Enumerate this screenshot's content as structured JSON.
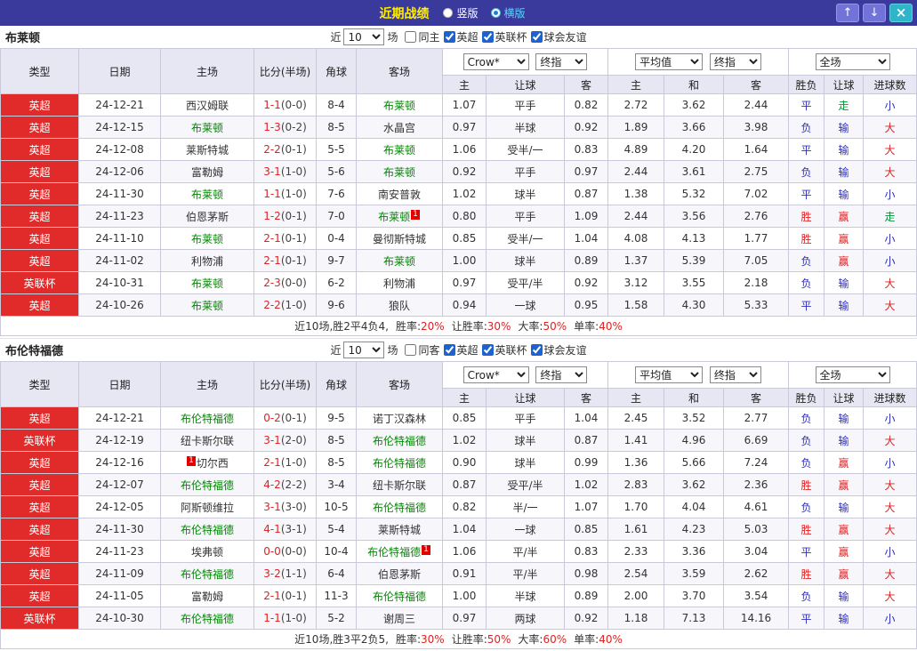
{
  "topbar": {
    "title": "近期战绩",
    "radios": [
      {
        "label": "竖版",
        "selected": false
      },
      {
        "label": "横版",
        "selected": true
      }
    ],
    "buttons": {
      "up": "↑",
      "down": "↓",
      "close": "×"
    }
  },
  "filter_labels": {
    "near": "近",
    "games": "场"
  },
  "table_headers": {
    "col_labels": [
      "类型",
      "日期",
      "主场",
      "比分(半场)",
      "角球",
      "客场"
    ],
    "sub_labels": [
      "主",
      "让球",
      "客",
      "主",
      "和",
      "客",
      "胜负",
      "让球",
      "进球数"
    ],
    "selects": {
      "source": "Crow*",
      "final": "终指",
      "average": "平均值",
      "scope": "全场"
    }
  },
  "result_colors": {
    "胜": "#e02222",
    "赢": "#e02222",
    "大": "#e02222",
    "负": "#2d2dbe",
    "输": "#2d2dbe",
    "小": "#2d2dbe",
    "平": "#2d2dbe",
    "走": "#009933"
  },
  "sections": [
    {
      "team": "布莱顿",
      "filter": {
        "count": "10",
        "same_label": "同主",
        "same_checked": false,
        "leagues": [
          {
            "label": "英超",
            "checked": true
          },
          {
            "label": "英联杯",
            "checked": true
          },
          {
            "label": "球会友谊",
            "checked": true
          }
        ]
      },
      "rows": [
        {
          "league": "英超",
          "date": "24-12-21",
          "home": "西汉姆联",
          "home_focus": false,
          "score": "1-1",
          "half": "(0-0)",
          "corner": "8-4",
          "away": "布莱顿",
          "away_focus": true,
          "odds": [
            "1.07",
            "平手",
            "0.82"
          ],
          "avg": [
            "2.72",
            "3.62",
            "2.44"
          ],
          "results": [
            "平",
            "走",
            "小"
          ]
        },
        {
          "league": "英超",
          "date": "24-12-15",
          "home": "布莱顿",
          "home_focus": true,
          "score": "1-3",
          "half": "(0-2)",
          "corner": "8-5",
          "away": "水晶宫",
          "away_focus": false,
          "odds": [
            "0.97",
            "半球",
            "0.92"
          ],
          "avg": [
            "1.89",
            "3.66",
            "3.98"
          ],
          "results": [
            "负",
            "输",
            "大"
          ]
        },
        {
          "league": "英超",
          "date": "24-12-08",
          "home": "莱斯特城",
          "home_focus": false,
          "score": "2-2",
          "half": "(0-1)",
          "corner": "5-5",
          "away": "布莱顿",
          "away_focus": true,
          "odds": [
            "1.06",
            "受半/一",
            "0.83"
          ],
          "avg": [
            "4.89",
            "4.20",
            "1.64"
          ],
          "results": [
            "平",
            "输",
            "大"
          ]
        },
        {
          "league": "英超",
          "date": "24-12-06",
          "home": "富勒姆",
          "home_focus": false,
          "score": "3-1",
          "half": "(1-0)",
          "corner": "5-6",
          "away": "布莱顿",
          "away_focus": true,
          "odds": [
            "0.92",
            "平手",
            "0.97"
          ],
          "avg": [
            "2.44",
            "3.61",
            "2.75"
          ],
          "results": [
            "负",
            "输",
            "大"
          ]
        },
        {
          "league": "英超",
          "date": "24-11-30",
          "home": "布莱顿",
          "home_focus": true,
          "score": "1-1",
          "half": "(1-0)",
          "corner": "7-6",
          "away": "南安普敦",
          "away_focus": false,
          "odds": [
            "1.02",
            "球半",
            "0.87"
          ],
          "avg": [
            "1.38",
            "5.32",
            "7.02"
          ],
          "results": [
            "平",
            "输",
            "小"
          ]
        },
        {
          "league": "英超",
          "date": "24-11-23",
          "home": "伯恩茅斯",
          "home_focus": false,
          "score": "1-2",
          "half": "(0-1)",
          "corner": "7-0",
          "away": "布莱顿",
          "away_focus": true,
          "away_badge": "1",
          "away_badge_side": "right",
          "odds": [
            "0.80",
            "平手",
            "1.09"
          ],
          "avg": [
            "2.44",
            "3.56",
            "2.76"
          ],
          "results": [
            "胜",
            "赢",
            "走"
          ]
        },
        {
          "league": "英超",
          "date": "24-11-10",
          "home": "布莱顿",
          "home_focus": true,
          "score": "2-1",
          "half": "(0-1)",
          "corner": "0-4",
          "away": "曼彻斯特城",
          "away_focus": false,
          "odds": [
            "0.85",
            "受半/一",
            "1.04"
          ],
          "avg": [
            "4.08",
            "4.13",
            "1.77"
          ],
          "results": [
            "胜",
            "赢",
            "小"
          ]
        },
        {
          "league": "英超",
          "date": "24-11-02",
          "home": "利物浦",
          "home_focus": false,
          "score": "2-1",
          "half": "(0-1)",
          "corner": "9-7",
          "away": "布莱顿",
          "away_focus": true,
          "odds": [
            "1.00",
            "球半",
            "0.89"
          ],
          "avg": [
            "1.37",
            "5.39",
            "7.05"
          ],
          "results": [
            "负",
            "赢",
            "小"
          ]
        },
        {
          "league": "英联杯",
          "date": "24-10-31",
          "home": "布莱顿",
          "home_focus": true,
          "score": "2-3",
          "half": "(0-0)",
          "corner": "6-2",
          "away": "利物浦",
          "away_focus": false,
          "odds": [
            "0.97",
            "受平/半",
            "0.92"
          ],
          "avg": [
            "3.12",
            "3.55",
            "2.18"
          ],
          "results": [
            "负",
            "输",
            "大"
          ]
        },
        {
          "league": "英超",
          "date": "24-10-26",
          "home": "布莱顿",
          "home_focus": true,
          "score": "2-2",
          "half": "(1-0)",
          "corner": "9-6",
          "away": "狼队",
          "away_focus": false,
          "odds": [
            "0.94",
            "一球",
            "0.95"
          ],
          "avg": [
            "1.58",
            "4.30",
            "5.33"
          ],
          "results": [
            "平",
            "输",
            "大"
          ]
        }
      ],
      "summary": {
        "prefix": "近10场,胜2平4负4,",
        "stats": [
          {
            "label": "胜率:",
            "value": "20%"
          },
          {
            "label": "让胜率:",
            "value": "30%"
          },
          {
            "label": "大率:",
            "value": "50%"
          },
          {
            "label": "单率:",
            "value": "40%"
          }
        ]
      }
    },
    {
      "team": "布伦特福德",
      "filter": {
        "count": "10",
        "same_label": "同客",
        "same_checked": false,
        "leagues": [
          {
            "label": "英超",
            "checked": true
          },
          {
            "label": "英联杯",
            "checked": true
          },
          {
            "label": "球会友谊",
            "checked": true
          }
        ]
      },
      "rows": [
        {
          "league": "英超",
          "date": "24-12-21",
          "home": "布伦特福德",
          "home_focus": true,
          "score": "0-2",
          "half": "(0-1)",
          "corner": "9-5",
          "away": "诺丁汉森林",
          "away_focus": false,
          "odds": [
            "0.85",
            "平手",
            "1.04"
          ],
          "avg": [
            "2.45",
            "3.52",
            "2.77"
          ],
          "results": [
            "负",
            "输",
            "小"
          ]
        },
        {
          "league": "英联杯",
          "date": "24-12-19",
          "home": "纽卡斯尔联",
          "home_focus": false,
          "score": "3-1",
          "half": "(2-0)",
          "corner": "8-5",
          "away": "布伦特福德",
          "away_focus": true,
          "odds": [
            "1.02",
            "球半",
            "0.87"
          ],
          "avg": [
            "1.41",
            "4.96",
            "6.69"
          ],
          "results": [
            "负",
            "输",
            "大"
          ]
        },
        {
          "league": "英超",
          "date": "24-12-16",
          "home": "切尔西",
          "home_focus": false,
          "home_badge": "1",
          "home_badge_side": "left",
          "score": "2-1",
          "half": "(1-0)",
          "corner": "8-5",
          "away": "布伦特福德",
          "away_focus": true,
          "odds": [
            "0.90",
            "球半",
            "0.99"
          ],
          "avg": [
            "1.36",
            "5.66",
            "7.24"
          ],
          "results": [
            "负",
            "赢",
            "小"
          ]
        },
        {
          "league": "英超",
          "date": "24-12-07",
          "home": "布伦特福德",
          "home_focus": true,
          "score": "4-2",
          "half": "(2-2)",
          "corner": "3-4",
          "away": "纽卡斯尔联",
          "away_focus": false,
          "odds": [
            "0.87",
            "受平/半",
            "1.02"
          ],
          "avg": [
            "2.83",
            "3.62",
            "2.36"
          ],
          "results": [
            "胜",
            "赢",
            "大"
          ]
        },
        {
          "league": "英超",
          "date": "24-12-05",
          "home": "阿斯顿维拉",
          "home_focus": false,
          "score": "3-1",
          "half": "(3-0)",
          "corner": "10-5",
          "away": "布伦特福德",
          "away_focus": true,
          "odds": [
            "0.82",
            "半/一",
            "1.07"
          ],
          "avg": [
            "1.70",
            "4.04",
            "4.61"
          ],
          "results": [
            "负",
            "输",
            "大"
          ]
        },
        {
          "league": "英超",
          "date": "24-11-30",
          "home": "布伦特福德",
          "home_focus": true,
          "score": "4-1",
          "half": "(3-1)",
          "corner": "5-4",
          "away": "莱斯特城",
          "away_focus": false,
          "odds": [
            "1.04",
            "一球",
            "0.85"
          ],
          "avg": [
            "1.61",
            "4.23",
            "5.03"
          ],
          "results": [
            "胜",
            "赢",
            "大"
          ]
        },
        {
          "league": "英超",
          "date": "24-11-23",
          "home": "埃弗顿",
          "home_focus": false,
          "score": "0-0",
          "half": "(0-0)",
          "corner": "10-4",
          "away": "布伦特福德",
          "away_focus": true,
          "away_badge": "1",
          "away_badge_side": "right",
          "odds": [
            "1.06",
            "平/半",
            "0.83"
          ],
          "avg": [
            "2.33",
            "3.36",
            "3.04"
          ],
          "results": [
            "平",
            "赢",
            "小"
          ]
        },
        {
          "league": "英超",
          "date": "24-11-09",
          "home": "布伦特福德",
          "home_focus": true,
          "score": "3-2",
          "half": "(1-1)",
          "corner": "6-4",
          "away": "伯恩茅斯",
          "away_focus": false,
          "odds": [
            "0.91",
            "平/半",
            "0.98"
          ],
          "avg": [
            "2.54",
            "3.59",
            "2.62"
          ],
          "results": [
            "胜",
            "赢",
            "大"
          ]
        },
        {
          "league": "英超",
          "date": "24-11-05",
          "home": "富勒姆",
          "home_focus": false,
          "score": "2-1",
          "half": "(0-1)",
          "corner": "11-3",
          "away": "布伦特福德",
          "away_focus": true,
          "odds": [
            "1.00",
            "半球",
            "0.89"
          ],
          "avg": [
            "2.00",
            "3.70",
            "3.54"
          ],
          "results": [
            "负",
            "输",
            "大"
          ]
        },
        {
          "league": "英联杯",
          "date": "24-10-30",
          "home": "布伦特福德",
          "home_focus": true,
          "score": "1-1",
          "half": "(1-0)",
          "corner": "5-2",
          "away": "谢周三",
          "away_focus": false,
          "odds": [
            "0.97",
            "两球",
            "0.92"
          ],
          "avg": [
            "1.18",
            "7.13",
            "14.16"
          ],
          "results": [
            "平",
            "输",
            "小"
          ]
        }
      ],
      "summary": {
        "prefix": "近10场,胜3平2负5,",
        "stats": [
          {
            "label": "胜率:",
            "value": "30%"
          },
          {
            "label": "让胜率:",
            "value": "50%"
          },
          {
            "label": "大率:",
            "value": "60%"
          },
          {
            "label": "单率:",
            "value": "40%"
          }
        ]
      }
    }
  ]
}
